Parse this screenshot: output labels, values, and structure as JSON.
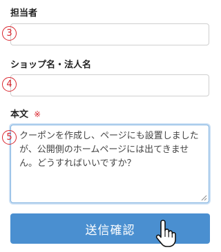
{
  "form": {
    "person_in_charge": {
      "label": "担当者",
      "value": "",
      "step_number": "3"
    },
    "shop_name": {
      "label": "ショップ名・法人名",
      "value": "",
      "step_number": "4"
    },
    "body": {
      "label": "本文",
      "required_mark": "※",
      "value": "クーポンを作成し、ページにも設置しましたが、公開側のホームページには出てきません。どうすればいいですか？",
      "step_number": "5"
    },
    "submit_label": "送信確認"
  },
  "colors": {
    "accent": "#4a8fd0",
    "required": "#d9232b",
    "step_circle": "#d9232b"
  },
  "icons": {
    "cursor": "hand-pointer-icon",
    "resize": "resize-grip-icon"
  }
}
